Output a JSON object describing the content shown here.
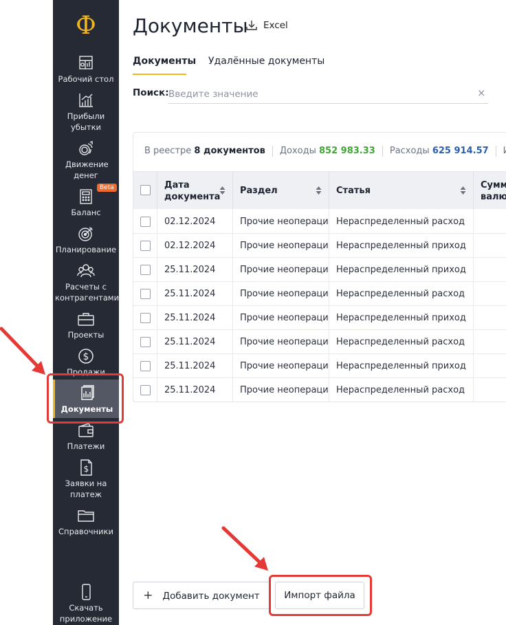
{
  "sidebar": {
    "logo": "Ф",
    "beta_badge": "Beta",
    "items": [
      {
        "label": "Рабочий стол",
        "icon": "dashboard-icon"
      },
      {
        "label": "Прибыли убытки",
        "icon": "chart-growth-icon"
      },
      {
        "label": "Движение денег",
        "icon": "money-flow-icon"
      },
      {
        "label": "Баланс",
        "icon": "calculator-icon"
      },
      {
        "label": "Планирование",
        "icon": "target-icon"
      },
      {
        "label": "Расчеты с контрагентами",
        "icon": "people-icon"
      },
      {
        "label": "Проекты",
        "icon": "briefcase-icon"
      },
      {
        "label": "Продажи",
        "icon": "dollar-circle-icon"
      },
      {
        "label": "Документы",
        "icon": "documents-icon",
        "active": true
      },
      {
        "label": "Платежи",
        "icon": "wallet-icon"
      },
      {
        "label": "Заявки на платеж",
        "icon": "dollar-document-icon"
      },
      {
        "label": "Справочники",
        "icon": "folder-icon"
      },
      {
        "label": "Скачать приложение",
        "icon": "phone-icon"
      }
    ]
  },
  "header": {
    "title": "Документы",
    "excel_label": "Excel"
  },
  "tabs": [
    {
      "label": "Документы",
      "active": true
    },
    {
      "label": "Удалённые документы",
      "active": false
    }
  ],
  "search": {
    "label": "Поиск:",
    "placeholder": "Введите значение",
    "clear": "×"
  },
  "summary": {
    "prefix": "В реестре",
    "count": "8 документов",
    "income_label": "Доходы",
    "income_value": "852 983.33",
    "expense_label": "Расходы",
    "expense_value": "625 914.57",
    "total_label": "Ит"
  },
  "table": {
    "columns": [
      "Дата документа",
      "Раздел",
      "Статья",
      "Сумм валют"
    ],
    "rows": [
      {
        "date": "02.12.2024",
        "section": "Прочие неоперационные",
        "article": "Нераспределенный расход"
      },
      {
        "date": "02.12.2024",
        "section": "Прочие неоперационные",
        "article": "Нераспределенный приход"
      },
      {
        "date": "25.11.2024",
        "section": "Прочие неоперационные",
        "article": "Нераспределенный приход"
      },
      {
        "date": "25.11.2024",
        "section": "Прочие неоперационные",
        "article": "Нераспределенный расход"
      },
      {
        "date": "25.11.2024",
        "section": "Прочие неоперационные",
        "article": "Нераспределенный приход"
      },
      {
        "date": "25.11.2024",
        "section": "Прочие неоперационные",
        "article": "Нераспределенный расход"
      },
      {
        "date": "25.11.2024",
        "section": "Прочие неоперационные",
        "article": "Нераспределенный приход"
      },
      {
        "date": "25.11.2024",
        "section": "Прочие неоперационные",
        "article": "Нераспределенный расход"
      }
    ]
  },
  "actions": {
    "add_document": "Добавить документ",
    "add_icon": "+",
    "import_file": "Импорт файла"
  },
  "colors": {
    "sidebar_bg": "#262a35",
    "accent": "#f2b51b",
    "income": "#3fa535",
    "expense": "#2a5fa8",
    "annotation": "#e53935"
  }
}
